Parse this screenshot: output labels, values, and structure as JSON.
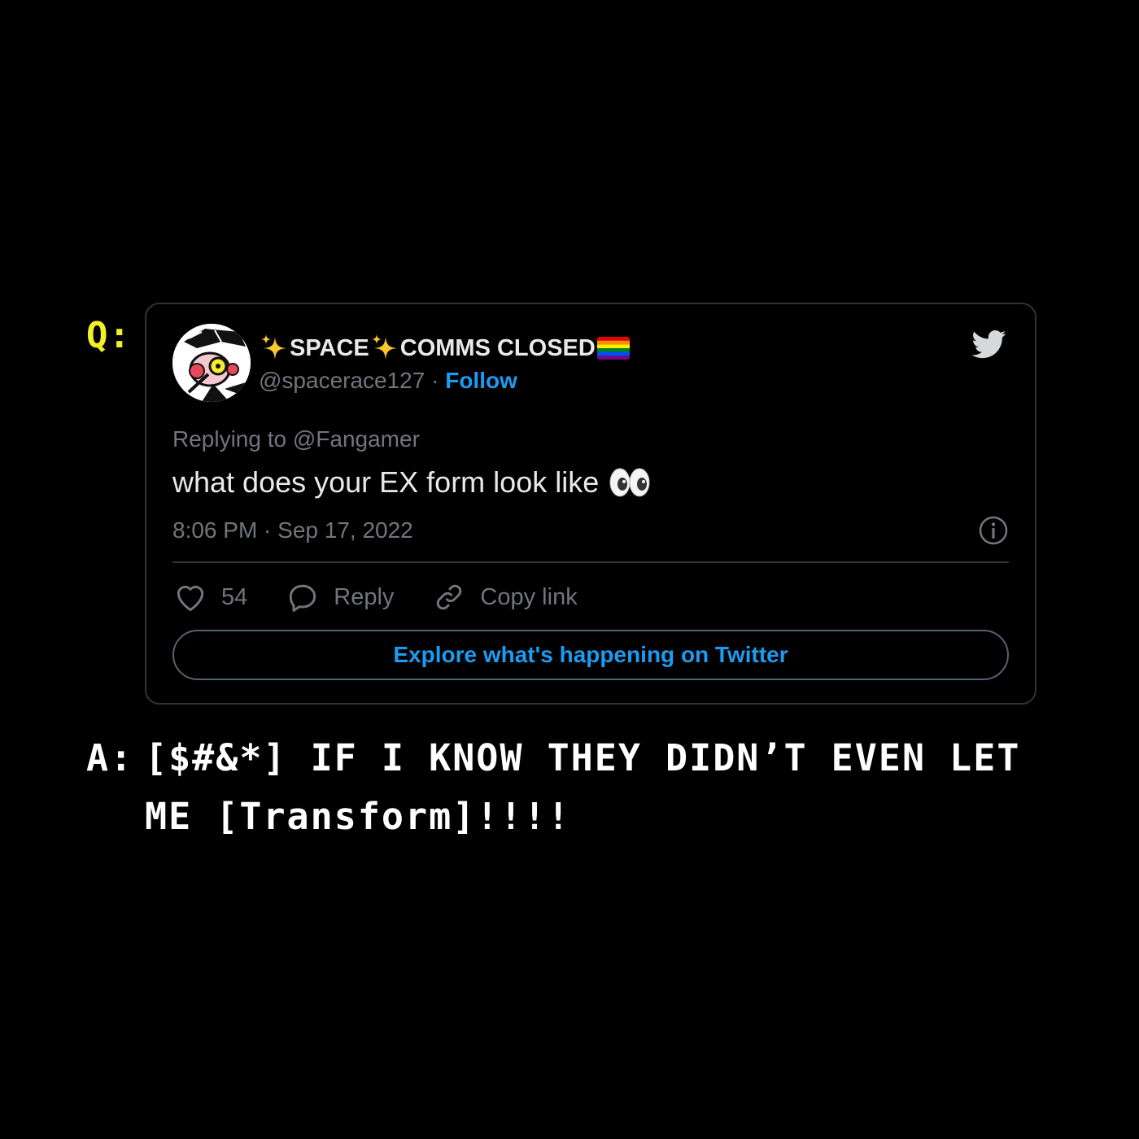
{
  "question_label": "Q:",
  "tweet": {
    "display_name_part1": "SPACE",
    "display_name_part2": "COMMS CLOSED",
    "handle": "@spacerace127",
    "separator": "·",
    "follow_label": "Follow",
    "replying_to": "Replying to @Fangamer",
    "text": "what does your EX form look like",
    "timestamp": "8:06 PM · Sep 17, 2022",
    "likes_count": "54",
    "reply_label": "Reply",
    "copy_link_label": "Copy link",
    "explore_label": "Explore what's happening on Twitter",
    "colors": {
      "accent": "#1d9bf0",
      "text_primary": "#e7e9ea",
      "text_secondary": "#71767b",
      "border": "#2f3336"
    }
  },
  "answer": {
    "prefix": "A:",
    "line1": "[$#&*] IF I KNOW THEY DIDN’T EVEN LET",
    "line2": "ME [Transform]!!!!"
  },
  "icons": [
    "sparkles-icon",
    "rainbow-flag-icon",
    "twitter-bird-icon",
    "eyes-icon",
    "info-icon",
    "heart-icon",
    "reply-bubble-icon",
    "link-icon"
  ],
  "page_colors": {
    "background": "#000000",
    "question_label": "#f3f028",
    "answer_text": "#ffffff"
  }
}
